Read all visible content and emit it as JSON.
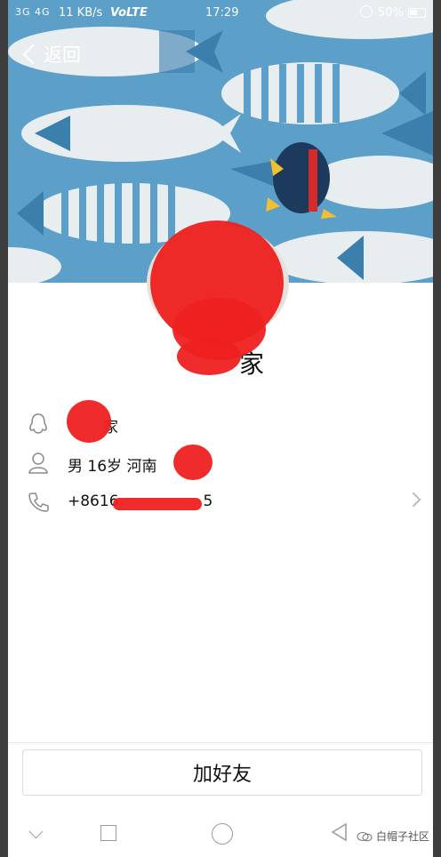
{
  "status_bar": {
    "signal": "3G 4G",
    "network_speed": "11 KB/s",
    "volte": "VoLTE",
    "time": "17:29",
    "battery_percent": "50%"
  },
  "header": {
    "back_label": "返回"
  },
  "profile": {
    "name_visible": "家"
  },
  "info": {
    "qq_nick_visible": "家",
    "personal": "男  16岁  河南",
    "phone_visible": "+8616",
    "phone_tail": "5"
  },
  "actions": {
    "add_friend_label": "加好友"
  },
  "watermark": {
    "text": "白帽子社区"
  },
  "colors": {
    "header_bg": "#5c9fc8",
    "fish_light": "#e8edf0",
    "fish_dark": "#3b7fad",
    "penguin_body": "#1c3a5c",
    "penguin_scarf": "#d62b2b",
    "redaction": "#ee2020"
  }
}
